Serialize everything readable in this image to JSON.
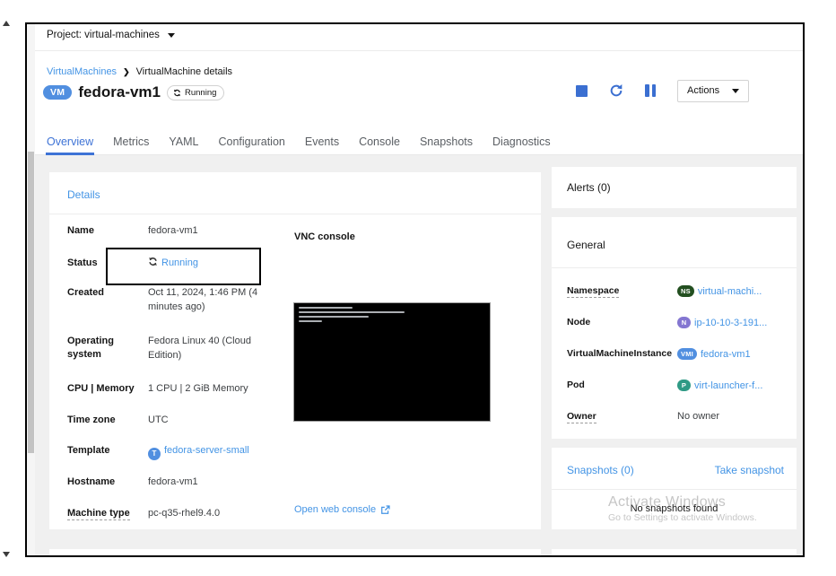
{
  "project_bar": {
    "label": "Project: virtual-machines"
  },
  "breadcrumb": {
    "link": "VirtualMachines",
    "separator": "❯",
    "current": "VirtualMachine details"
  },
  "header": {
    "kind_badge": "VM",
    "title": "fedora-vm1",
    "status": "Running",
    "actions_label": "Actions",
    "icons": {
      "stop": "stop-icon",
      "restart": "restart-icon",
      "pause": "pause-icon"
    }
  },
  "tabs": {
    "active": "Overview",
    "items": [
      "Overview",
      "Metrics",
      "YAML",
      "Configuration",
      "Events",
      "Console",
      "Snapshots",
      "Diagnostics"
    ]
  },
  "details_card": {
    "title": "Details",
    "rows": [
      {
        "label": "Name",
        "value": "fedora-vm1"
      },
      {
        "label": "Status",
        "value": "Running"
      },
      {
        "label": "Created",
        "value": "Oct 11, 2024, 1:46 PM (4 minutes ago)"
      },
      {
        "label": "Operating system",
        "value": "Fedora Linux 40 (Cloud Edition)"
      },
      {
        "label": "CPU | Memory",
        "value": "1 CPU | 2 GiB Memory"
      },
      {
        "label": "Time zone",
        "value": "UTC"
      },
      {
        "label": "Template",
        "value": "fedora-server-small",
        "badge": "T"
      },
      {
        "label": "Hostname",
        "value": "fedora-vm1"
      },
      {
        "label": "Machine type",
        "value": "pc-q35-rhel9.4.0"
      }
    ],
    "vnc": {
      "title": "VNC console",
      "open_link": "Open web console"
    }
  },
  "alerts_card": {
    "title": "Alerts (0)"
  },
  "general_card": {
    "title": "General",
    "rows": [
      {
        "label": "Namespace",
        "badge": "NS",
        "badge_color": "#234f20",
        "value": "virtual-machi..."
      },
      {
        "label": "Node",
        "badge": "N",
        "badge_color": "#8476d1",
        "value": "ip-10-10-3-191..."
      },
      {
        "label": "VirtualMachineInstance",
        "badge": "VMI",
        "badge_color": "#518fe0",
        "value": "fedora-vm1"
      },
      {
        "label": "Pod",
        "badge": "P",
        "badge_color": "#2f9a85",
        "value": "virt-launcher-f..."
      },
      {
        "label": "Owner",
        "value": "No owner"
      }
    ]
  },
  "snapshots_card": {
    "title": "Snapshots (0)",
    "action_label": "Take snapshot",
    "empty_message": "No snapshots found"
  },
  "watermark": {
    "line1": "Activate Windows",
    "line2": "Go to Settings to activate Windows."
  },
  "colors": {
    "accent_blue": "#3b6fd1",
    "link_blue": "#4394e5",
    "background_gray": "#f0f0f0"
  }
}
